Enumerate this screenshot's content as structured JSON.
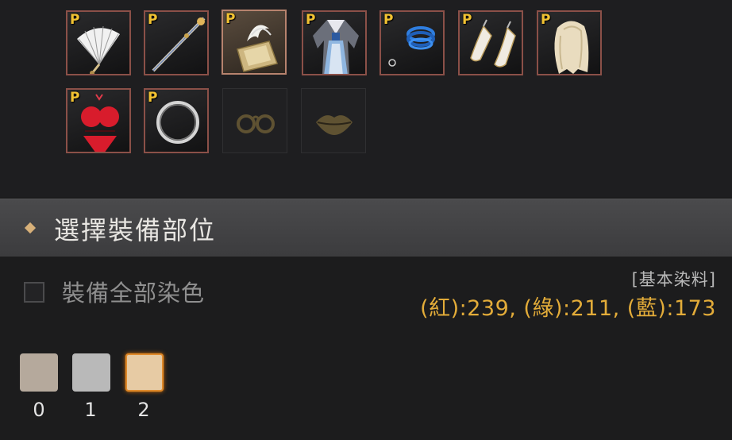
{
  "equipment": {
    "premium_badge": "P",
    "slots": [
      {
        "item": "folding-fan",
        "premium": true
      },
      {
        "item": "staff-weapon",
        "premium": true
      },
      {
        "item": "scroll-book",
        "premium": true,
        "selected": true
      },
      {
        "item": "hanbok-outfit",
        "premium": true
      },
      {
        "item": "blue-bracelet",
        "premium": true
      },
      {
        "item": "high-heel-shoes",
        "premium": true
      },
      {
        "item": "blonde-wig",
        "premium": true
      },
      {
        "item": "red-swimsuit",
        "premium": true
      },
      {
        "item": "silver-ring",
        "premium": true
      },
      {
        "item": "glasses",
        "premium": false,
        "empty": true
      },
      {
        "item": "lips",
        "premium": false,
        "empty": true
      }
    ]
  },
  "section": {
    "title": "選擇裝備部位"
  },
  "options": {
    "dye_all_label": "裝備全部染色",
    "dye_all_checked": false
  },
  "dye_info": {
    "title": "[基本染料]",
    "values_text": "(紅):239, (綠):211, (藍):173",
    "rgb": {
      "red": 239,
      "green": 211,
      "blue": 173
    }
  },
  "swatches": [
    {
      "label": "0",
      "color": "#b5a99c"
    },
    {
      "label": "1",
      "color": "#b9b9b9"
    },
    {
      "label": "2",
      "color": "#e7cba4",
      "active": true
    }
  ],
  "colors": {
    "accent": "#e3ac39",
    "badge": "#f1c232",
    "slot_border": "#8b5048",
    "active_swatch_border": "#e08a2b"
  }
}
